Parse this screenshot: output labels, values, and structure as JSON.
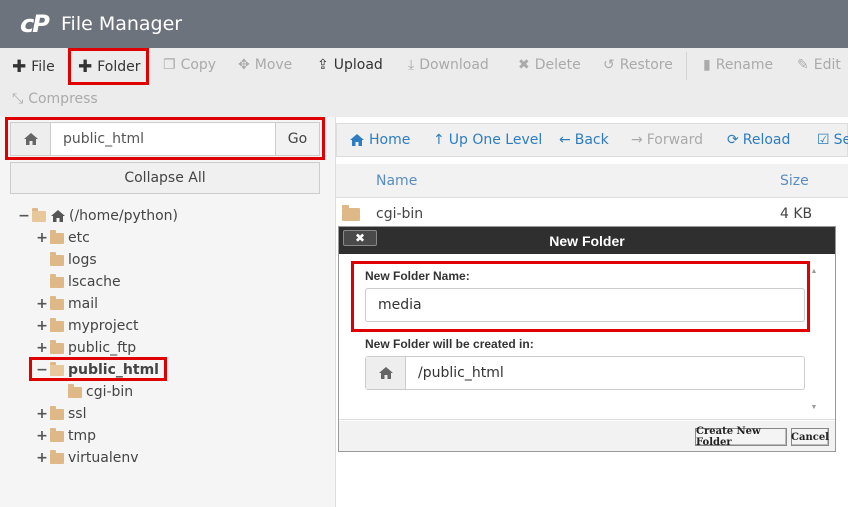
{
  "header": {
    "logo": "cP",
    "title": "File Manager"
  },
  "toolbar": {
    "file": "File",
    "folder": "Folder",
    "copy": "Copy",
    "move": "Move",
    "upload": "Upload",
    "download": "Download",
    "delete": "Delete",
    "restore": "Restore",
    "rename": "Rename",
    "edit": "Edit",
    "compress": "Compress"
  },
  "path_bar": {
    "value": "public_html",
    "go": "Go"
  },
  "collapse_all": "Collapse All",
  "tree": {
    "root": "(/home/python)",
    "items": [
      "etc",
      "logs",
      "lscache",
      "mail",
      "myproject",
      "public_ftp",
      "public_html",
      "cgi-bin",
      "ssl",
      "tmp",
      "virtualenv"
    ]
  },
  "nav": {
    "home": "Home",
    "up": "Up One Level",
    "back": "Back",
    "forward": "Forward",
    "reload": "Reload",
    "select": "Se"
  },
  "file_list": {
    "col_name": "Name",
    "col_size": "Size",
    "rows": [
      {
        "name": "cgi-bin",
        "size": "4 KB"
      }
    ]
  },
  "dialog": {
    "title": "New Folder",
    "close": "✖",
    "name_label": "New Folder Name:",
    "name_value": "media",
    "location_label": "New Folder will be created in:",
    "location_value": "/public_html",
    "create": "Create New Folder",
    "cancel": "Cancel"
  },
  "colors": {
    "header": "#6c737c",
    "link": "#2f7dbf",
    "highlight": "#e00000",
    "folder": "#deb887"
  }
}
